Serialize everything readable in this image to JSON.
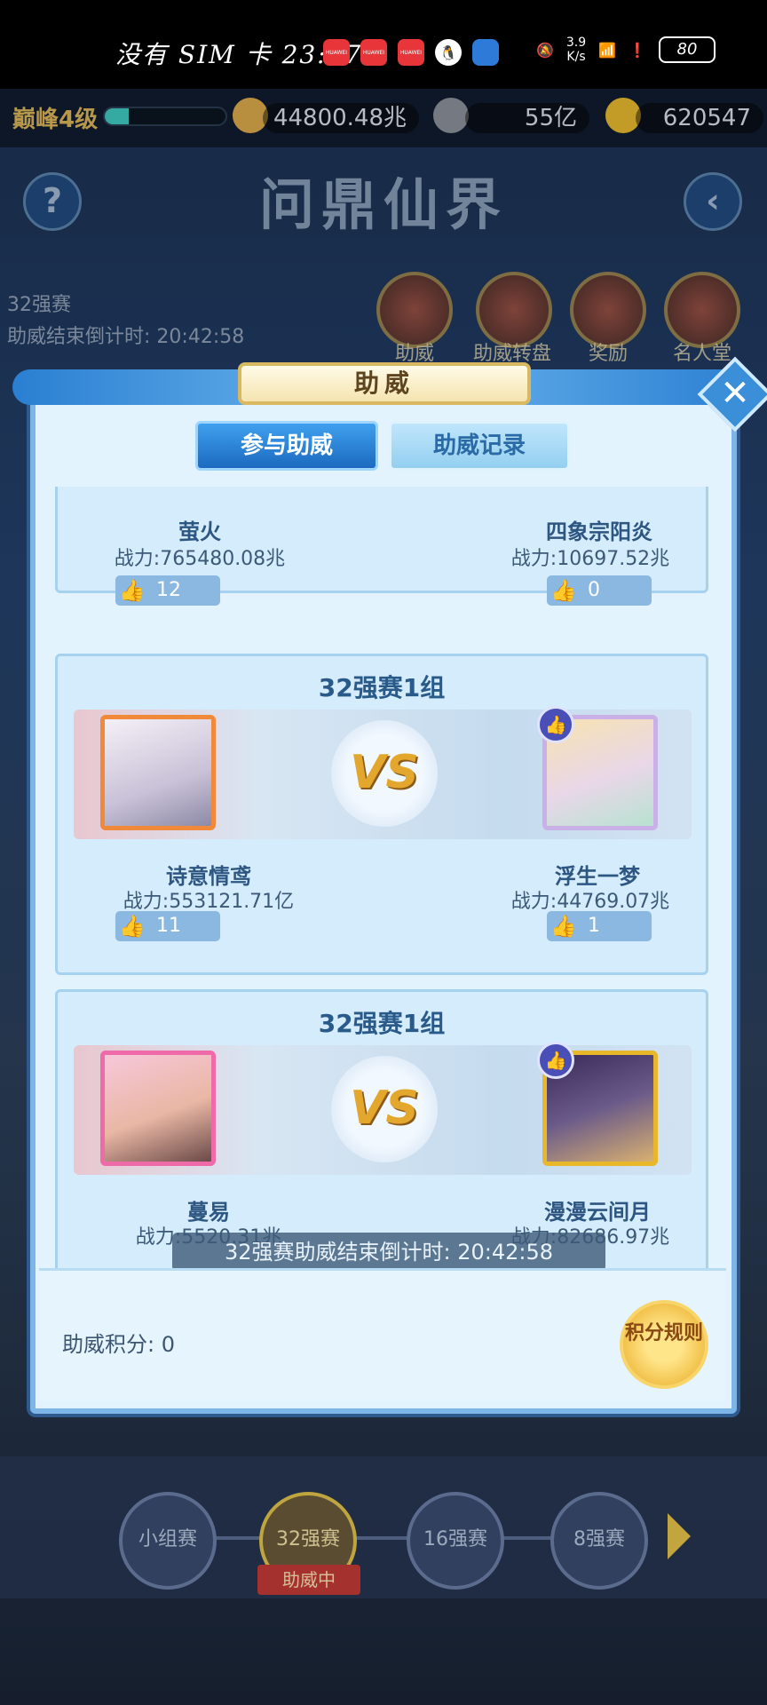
{
  "status_bar": {
    "carrier_text": "没有 SIM 卡 23:17",
    "app_icons": [
      "HUAWEI",
      "HUAWEI",
      "HUAWEI",
      "qq-icon",
      "browser-icon"
    ],
    "net_speed_top": "3.9",
    "net_speed_bottom": "K/s",
    "battery": "80"
  },
  "game": {
    "level_label": "巅峰4级",
    "level_progress": 0.2,
    "combat_power": "44800.48兆",
    "coins": "55亿",
    "gold": "620547",
    "title": "问鼎仙界",
    "help_icon": "?",
    "event_name": "32强赛",
    "event_countdown_label": "助威结束倒计时:",
    "event_countdown_value": "20:42:58",
    "menu": [
      {
        "label": "助威"
      },
      {
        "label": "助威转盘"
      },
      {
        "label": "奖励"
      },
      {
        "label": "名人堂"
      }
    ],
    "stages": [
      {
        "label": "小组赛"
      },
      {
        "label": "32强赛"
      },
      {
        "label": "16强赛"
      },
      {
        "label": "8强赛"
      }
    ],
    "active_stage_tag": "助威中"
  },
  "modal": {
    "title": "助威",
    "close_icon": "✕",
    "tabs": [
      {
        "label": "参与助威",
        "active": true
      },
      {
        "label": "助威记录",
        "active": false
      }
    ],
    "matches": [
      {
        "title": "",
        "left": {
          "name": "萤火",
          "power": "战力:765480.08兆",
          "likes": "12"
        },
        "right": {
          "name": "四象宗阳炎",
          "power": "战力:10697.52兆",
          "likes": "0"
        }
      },
      {
        "title": "32强赛1组",
        "vs": "VS",
        "left": {
          "name": "诗意情鸢",
          "power": "战力:553121.71亿",
          "likes": "11"
        },
        "right": {
          "name": "浮生一梦",
          "power": "战力:44769.07兆",
          "likes": "1"
        }
      },
      {
        "title": "32强赛1组",
        "vs": "VS",
        "left": {
          "name": "蔓易",
          "power": "战力:5520.31兆",
          "likes": ""
        },
        "right": {
          "name": "漫漫云间月",
          "power": "战力:82686.97兆",
          "likes": ""
        }
      }
    ],
    "countdown_banner": "32强赛助威结束倒计时: 20:42:58",
    "score_label": "助威积分: 0",
    "rules_button": "积分规则"
  },
  "colors": {
    "accent_blue": "#1c6ac0",
    "gold": "#e8a81e",
    "panel_bg": "#e3f3fd"
  }
}
